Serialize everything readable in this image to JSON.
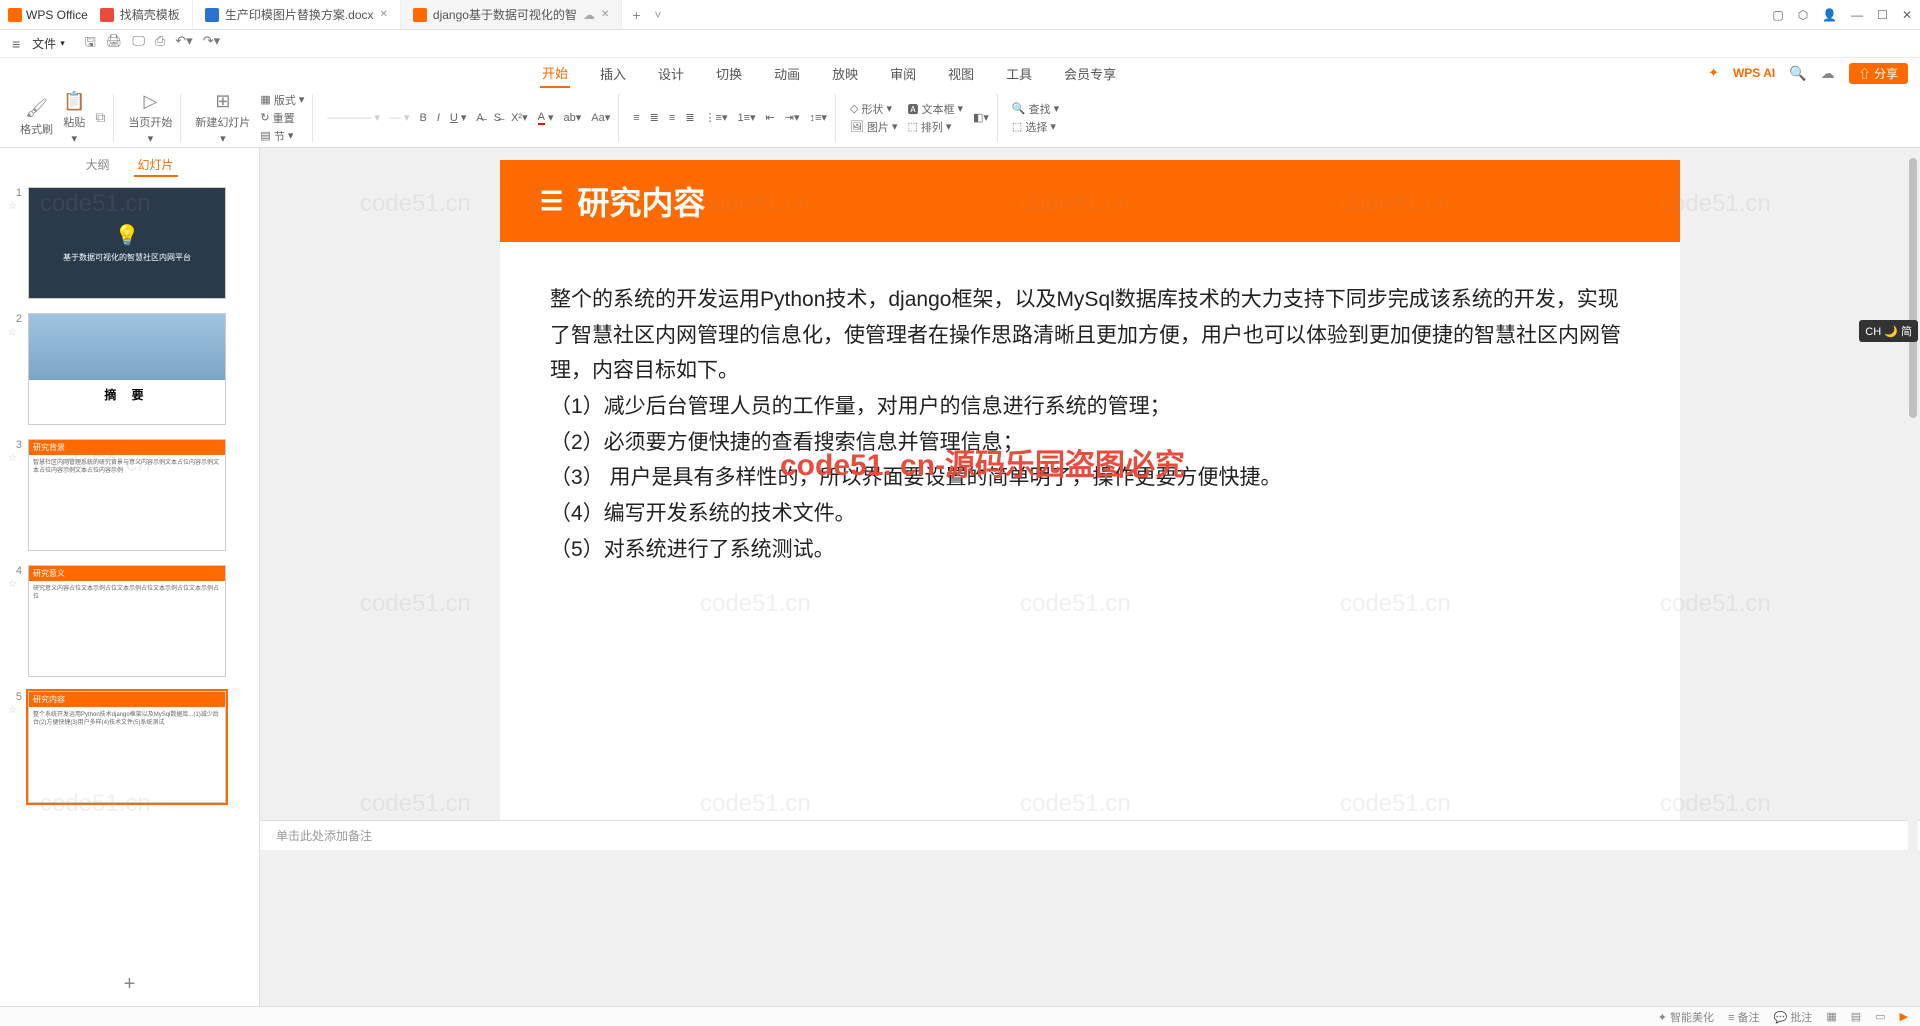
{
  "titlebar": {
    "app": "WPS Office",
    "tabs": [
      {
        "icon": "red",
        "label": "找稿壳模板"
      },
      {
        "icon": "blue",
        "label": "生产印模图片替换方案.docx"
      },
      {
        "icon": "orange",
        "label": "django基于数据可视化的智"
      }
    ]
  },
  "menu": {
    "file": "文件"
  },
  "ribbon_tabs": [
    "开始",
    "插入",
    "设计",
    "切换",
    "动画",
    "放映",
    "审阅",
    "视图",
    "工具",
    "会员专享"
  ],
  "wps_ai": "WPS AI",
  "share": "分享",
  "tools": {
    "format_brush": "格式刷",
    "paste": "粘贴",
    "from_current": "当页开始",
    "new_slide": "新建幻灯片",
    "layout": "版式",
    "reset": "重置",
    "section": "节",
    "shape": "形状",
    "picture": "图片",
    "textbox": "文本框",
    "arrange": "排列",
    "find": "查找",
    "select": "选择"
  },
  "panel": {
    "outline": "大纲",
    "slides": "幻灯片"
  },
  "thumbs": {
    "t1": "基于数据可视化的智慧社区内网平台",
    "t2": "摘  要",
    "t3_head": "研究背景",
    "t4_head": "研究意义",
    "t5_head": "研究内容"
  },
  "slide": {
    "title": "研究内容",
    "para": "整个的系统的开发运用Python技术，django框架，以及MySql数据库技术的大力支持下同步完成该系统的开发，实现了智慧社区内网管理的信息化，使管理者在操作思路清晰且更加方便，用户也可以体验到更加便捷的智慧社区内网管理，内容目标如下。",
    "items": [
      "（1）减少后台管理人员的工作量，对用户的信息进行系统的管理；",
      "（2）必须要方便快捷的查看搜索信息并管理信息；",
      "（3） 用户是具有多样性的，所以界面要设置的简单明了，操作更要方便快捷。",
      "（4）编写开发系统的技术文件。",
      "（5）对系统进行了系统测试。"
    ]
  },
  "watermark_main": "code51. cn-源码乐园盗图必究",
  "watermark_bg": "code51.cn",
  "notes_placeholder": "单击此处添加备注",
  "lang": "CH 🌙 简",
  "status": {
    "beautify": "智能美化",
    "notes": "备注",
    "comments": "批注"
  }
}
